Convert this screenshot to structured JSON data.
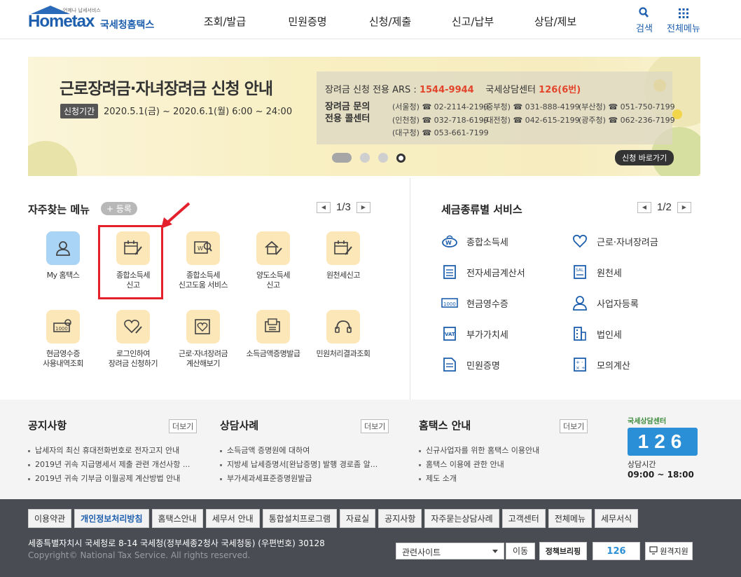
{
  "header": {
    "logo_word": "Hometax",
    "logo_tagline": "언제나 납세서비스",
    "logo_korean": "국세청홈택스",
    "nav": [
      "조회/발급",
      "민원증명",
      "신청/제출",
      "신고/납부",
      "상담/제보"
    ],
    "search_label": "검색",
    "allmenu_label": "전체메뉴"
  },
  "banner": {
    "title": "근로장려금·자녀장려금 신청 안내",
    "period_label": "신청기간",
    "period_text": "2020.5.1(금) ~ 2020.6.1(월) 6:00 ~ 24:00",
    "ars_label": "장려금 신청 전용 ARS :",
    "ars_number": "1544-9944",
    "center_label": "국세상담센터",
    "center_number": "126(6번)",
    "callcenter_title": "장려금 문의 전용 콜센터",
    "calls": [
      "(서울청) ☎ 02-2114-2199",
      "(중부청) ☎ 031-888-4199",
      "(부산청) ☎ 051-750-7199",
      "(인천청) ☎ 032-718-6199",
      "(대전청) ☎ 042-615-2199",
      "(광주청) ☎ 062-236-7199",
      "(대구청) ☎ 053-661-7199"
    ],
    "apply_button": "신청 바로가기"
  },
  "favorites": {
    "title": "자주찾는 메뉴",
    "register": "+ 등록",
    "page": "1/3",
    "items": [
      {
        "label": "My 홈택스"
      },
      {
        "label": "종합소득세\n신고"
      },
      {
        "label": "종합소득세\n신고도움 서비스"
      },
      {
        "label": "양도소득세\n신고"
      },
      {
        "label": "원천세신고"
      },
      {
        "label": "현금영수증\n사용내역조회"
      },
      {
        "label": "로그인하여\n장려금 신청하기"
      },
      {
        "label": "근로·자녀장려금\n계산해보기"
      },
      {
        "label": "소득금액증명발급"
      },
      {
        "label": "민원처리결과조회"
      }
    ]
  },
  "tax_services": {
    "title": "세금종류별 서비스",
    "page": "1/2",
    "items": [
      {
        "label": "종합소득세",
        "icon": "won-hand-icon"
      },
      {
        "label": "근로·자녀장려금",
        "icon": "heart-icon"
      },
      {
        "label": "전자세금계산서",
        "icon": "ledger-icon"
      },
      {
        "label": "원천세",
        "icon": "salary-doc-icon"
      },
      {
        "label": "현금영수증",
        "icon": "receipt-1000-icon"
      },
      {
        "label": "사업자등록",
        "icon": "person-icon"
      },
      {
        "label": "부가가치세",
        "icon": "vat-icon"
      },
      {
        "label": "법인세",
        "icon": "building-icon"
      },
      {
        "label": "민원증명",
        "icon": "document-icon"
      },
      {
        "label": "모의계산",
        "icon": "calculator-icon"
      }
    ]
  },
  "board": {
    "more_label": "더보기",
    "notice": {
      "title": "공지사항",
      "items": [
        "납세자의 최신 휴대전화번호로 전자고지 안내",
        "2019년 귀속 지급명세서 제출 관련 개선사항 ...",
        "2019년 귀속 기부금 이월공제 계산방법 안내"
      ]
    },
    "cases": {
      "title": "상담사례",
      "items": [
        "소득금액 증명원에 대하여",
        "지방세 납세증명서[완납증명] 발행 경로좀 알...",
        "부가세과세표준증명원발급"
      ]
    },
    "guide": {
      "title": "홈택스 안내",
      "items": [
        "신규사업자를 위한 홈택스 이용안내",
        "홈택스 이용에 관한 안내",
        "제도 소개"
      ]
    },
    "center": {
      "caption": "국세상담센터",
      "number": "126",
      "hours_label": "상담시간",
      "hours": "09:00 ~ 18:00"
    }
  },
  "footer": {
    "links": [
      "이용약관",
      "개인정보처리방침",
      "홈택스안내",
      "세무서 안내",
      "통합설치프로그램",
      "자료실",
      "공지사항",
      "자주묻는상담사례",
      "고객센터",
      "전체메뉴",
      "세무서식"
    ],
    "address": "세종특별자치시 국세청로 8-14 국세청(정부세종2청사 국세청동) (우편번호) 30128",
    "copyright": "Copyright© National Tax Service. All rights reserved.",
    "related_site": "관련사이트",
    "go_button": "이동",
    "banner_policy": "정책브리핑",
    "banner_126": "126",
    "banner_remote": "원격지원"
  },
  "colors": {
    "brand_blue": "#1d5fae",
    "highlight_red": "#e5202d",
    "ars_red": "#e2452b",
    "footer_bg": "#4a4c54"
  }
}
